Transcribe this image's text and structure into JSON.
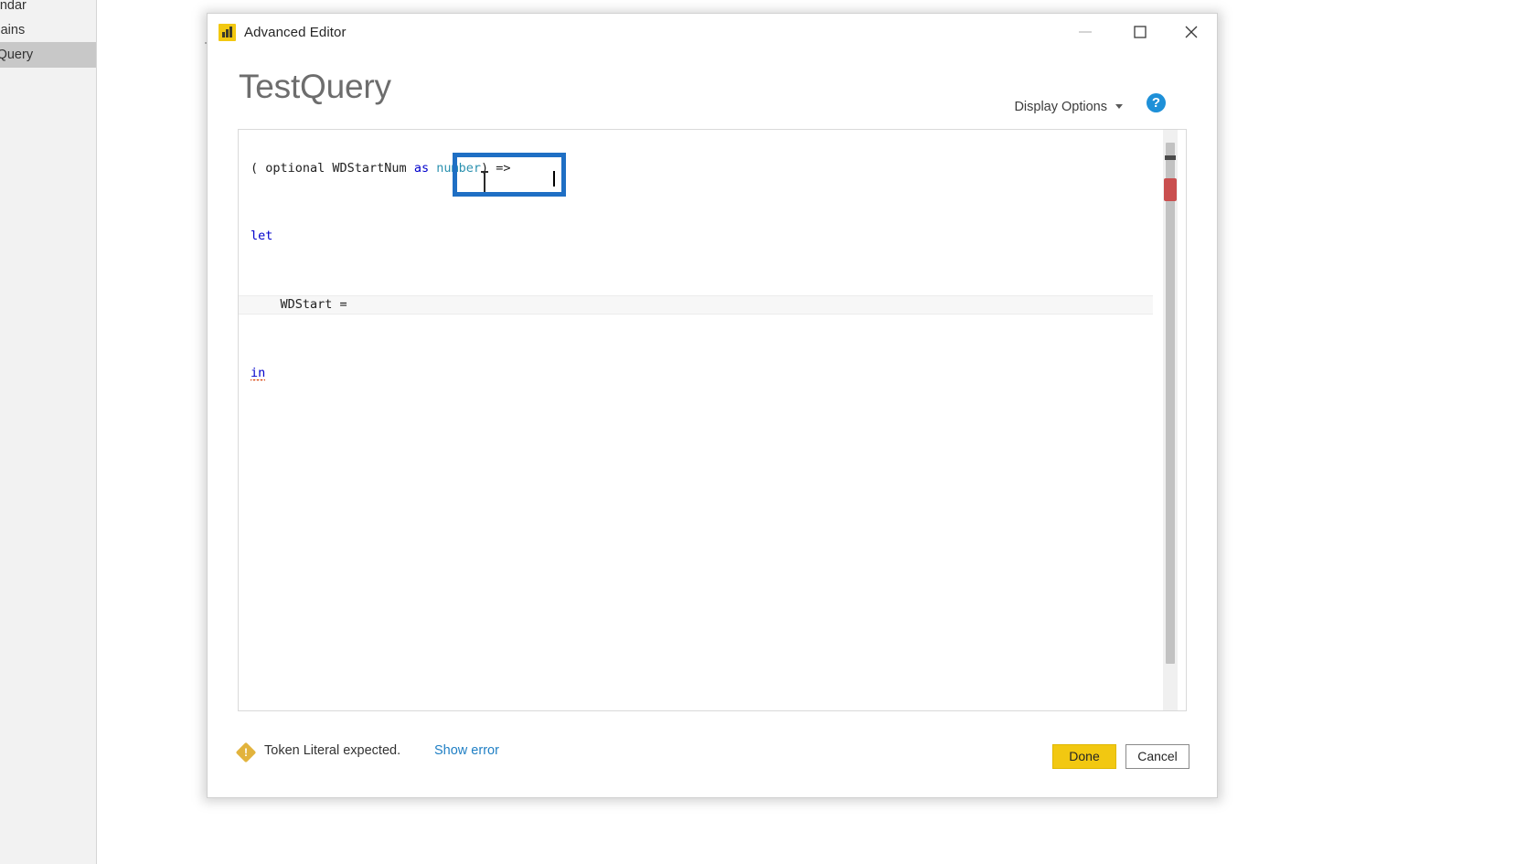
{
  "background": {
    "queries_pane": {
      "items": [
        {
          "label": "Calendar",
          "selected": false
        },
        {
          "label": "Domains",
          "selected": false
        },
        {
          "label": "TestQuery",
          "selected": true
        }
      ]
    }
  },
  "window": {
    "title": "Advanced Editor",
    "icon": "power-bi-icon",
    "controls": {
      "minimize": "—",
      "maximize": "☐",
      "close": "✕"
    }
  },
  "header": {
    "query_name": "TestQuery",
    "display_options_label": "Display Options",
    "help_label": "?"
  },
  "editor": {
    "lines": [
      {
        "indent": 0,
        "tokens": [
          {
            "text": "( optional WDStartNum ",
            "cls": "plain"
          },
          {
            "text": "as",
            "cls": "kw"
          },
          {
            "text": " ",
            "cls": "plain"
          },
          {
            "text": "number",
            "cls": "typ"
          },
          {
            "text": ") =>",
            "cls": "plain"
          }
        ]
      },
      {
        "indent": 0,
        "tokens": [
          {
            "text": "let",
            "cls": "kw"
          }
        ]
      },
      {
        "indent": 0,
        "current": true,
        "tokens": [
          {
            "text": "    WDStart = ",
            "cls": "plain"
          }
        ]
      },
      {
        "indent": 0,
        "tokens": [
          {
            "text": "in",
            "cls": "err"
          }
        ]
      }
    ],
    "cursor_visible": true,
    "scrollbar": {
      "has_error_marker": true,
      "error_marker_color": "#c94f4f",
      "overview_marker_color": "#4a4a4a"
    }
  },
  "annotation": {
    "color": "#1f6fc4",
    "target": "let-wdstart-block"
  },
  "status": {
    "icon": "warning-icon",
    "message": "Token Literal expected.",
    "link_label": "Show error"
  },
  "footer": {
    "done_label": "Done",
    "cancel_label": "Cancel",
    "done_color": "#f2c811"
  }
}
